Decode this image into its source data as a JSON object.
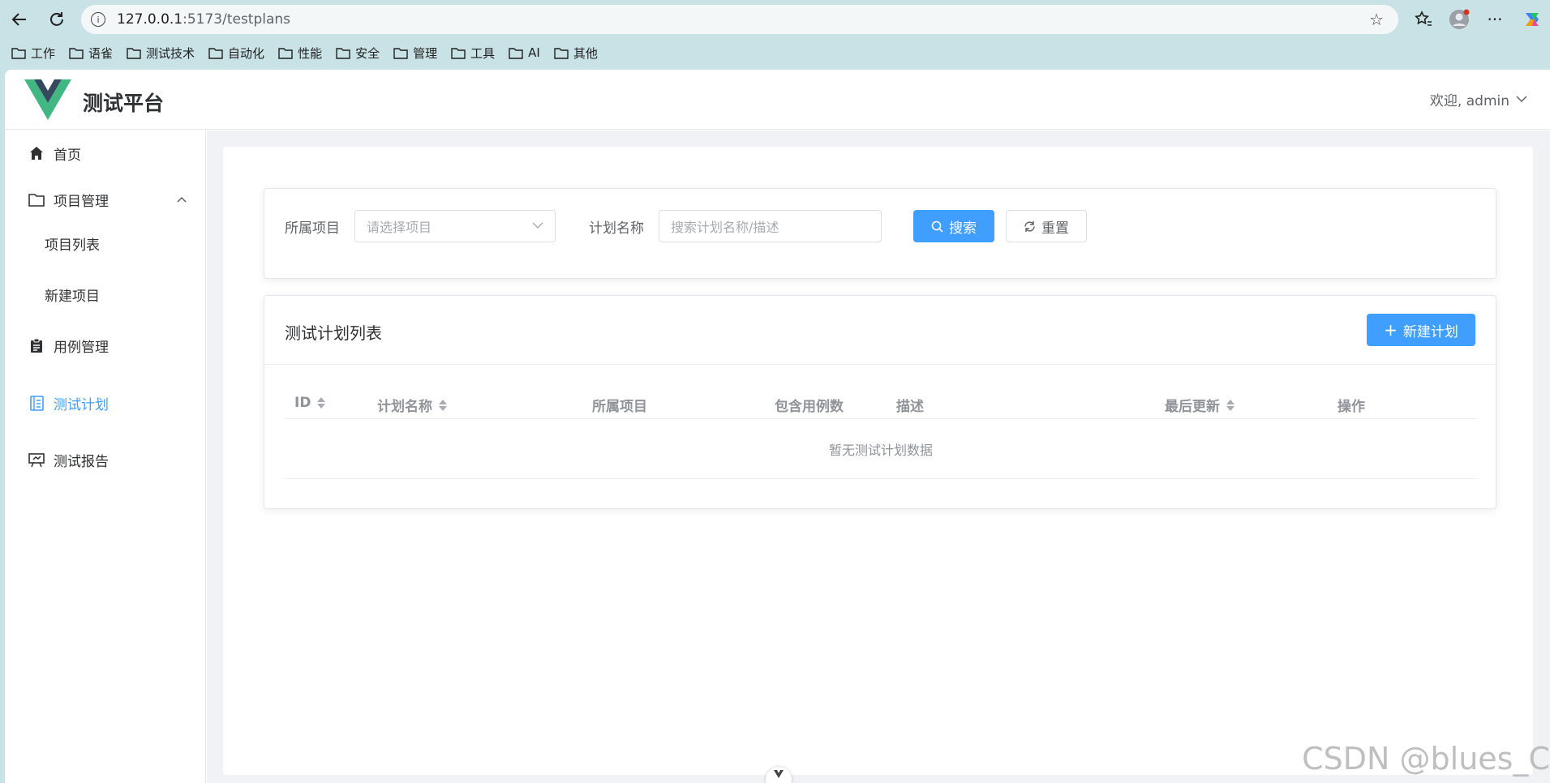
{
  "browser": {
    "url_host": "127.0.0.1",
    "url_rest": ":5173/testplans",
    "bookmarks": [
      "工作",
      "语雀",
      "测试技术",
      "自动化",
      "性能",
      "安全",
      "管理",
      "工具",
      "AI",
      "其他"
    ]
  },
  "header": {
    "brand": "测试平台",
    "welcome": "欢迎, admin"
  },
  "sidebar": {
    "items": [
      {
        "label": "首页",
        "icon": "home-icon"
      },
      {
        "label": "项目管理",
        "icon": "folder-icon"
      },
      {
        "label": "项目列表"
      },
      {
        "label": "新建项目"
      },
      {
        "label": "用例管理",
        "icon": "clipboard-icon"
      },
      {
        "label": "测试计划",
        "icon": "document-icon"
      },
      {
        "label": "测试报告",
        "icon": "presentation-icon"
      }
    ],
    "active_color": "#409eff"
  },
  "search": {
    "project_label": "所属项目",
    "project_placeholder": "请选择项目",
    "plan_label": "计划名称",
    "plan_placeholder": "搜索计划名称/描述",
    "search_button": "搜索",
    "reset_button": "重置"
  },
  "list": {
    "title": "测试计划列表",
    "new_button": "新建计划",
    "columns": [
      "ID",
      "计划名称",
      "所属项目",
      "包含用例数",
      "描述",
      "最后更新",
      "操作"
    ],
    "empty_text": "暂无测试计划数据"
  },
  "watermark": "CSDN @blues_C",
  "colors": {
    "primary": "#409eff",
    "browser_bg": "#c9e2e6"
  }
}
